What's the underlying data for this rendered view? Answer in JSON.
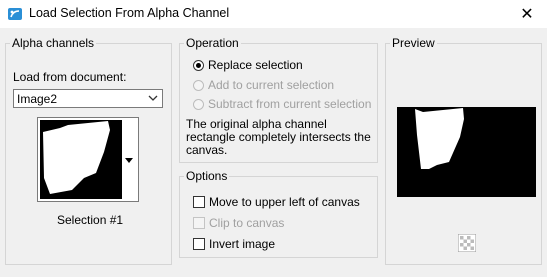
{
  "window": {
    "title": "Load Selection From Alpha Channel",
    "close_glyph": "✕",
    "app_icon": "paint-app-icon"
  },
  "alpha_channels": {
    "legend": "Alpha channels",
    "load_label": "Load from document:",
    "document_value": "Image2",
    "selection_caption": "Selection #1"
  },
  "operation": {
    "legend": "Operation",
    "options": [
      {
        "label": "Replace selection",
        "checked": true,
        "enabled": true
      },
      {
        "label": "Add to current selection",
        "checked": false,
        "enabled": false
      },
      {
        "label": "Subtract from current selection",
        "checked": false,
        "enabled": false
      }
    ],
    "info_lines": [
      "The original alpha channel",
      "rectangle completely intersects the",
      "canvas."
    ]
  },
  "options": {
    "legend": "Options",
    "items": [
      {
        "label": "Move to upper left of canvas",
        "checked": false,
        "enabled": true
      },
      {
        "label": "Clip to canvas",
        "checked": false,
        "enabled": false
      },
      {
        "label": "Invert image",
        "checked": false,
        "enabled": true
      }
    ]
  },
  "preview": {
    "legend": "Preview"
  }
}
